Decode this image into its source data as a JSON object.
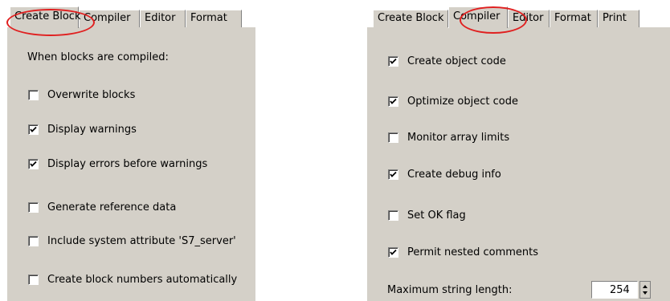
{
  "left_dialog": {
    "tabs": [
      "Create Block",
      "Compiler",
      "Editor",
      "Format"
    ],
    "active_tab": "Create Block",
    "heading": "When blocks are compiled:",
    "options": [
      {
        "label": "Overwrite blocks",
        "checked": false
      },
      {
        "label": "Display warnings",
        "checked": true
      },
      {
        "label": "Display errors before warnings",
        "checked": true
      },
      {
        "label": "Generate reference data",
        "checked": false
      },
      {
        "label": "Include system attribute 'S7_server'",
        "checked": false
      },
      {
        "label": "Create block numbers automatically",
        "checked": false
      }
    ]
  },
  "right_dialog": {
    "tabs": [
      "Create Block",
      "Compiler",
      "Editor",
      "Format",
      "Print"
    ],
    "active_tab": "Compiler",
    "options": [
      {
        "label": "Create object code",
        "checked": true
      },
      {
        "label": "Optimize object code",
        "checked": true
      },
      {
        "label": "Monitor array limits",
        "checked": false
      },
      {
        "label": "Create debug info",
        "checked": true
      },
      {
        "label": "Set OK flag",
        "checked": false
      },
      {
        "label": "Permit nested comments",
        "checked": true
      }
    ],
    "max_string_length_label": "Maximum string length:",
    "max_string_length_value": "254"
  },
  "colors": {
    "highlight": "#e02020",
    "dialog_bg": "#d4d0c8"
  }
}
